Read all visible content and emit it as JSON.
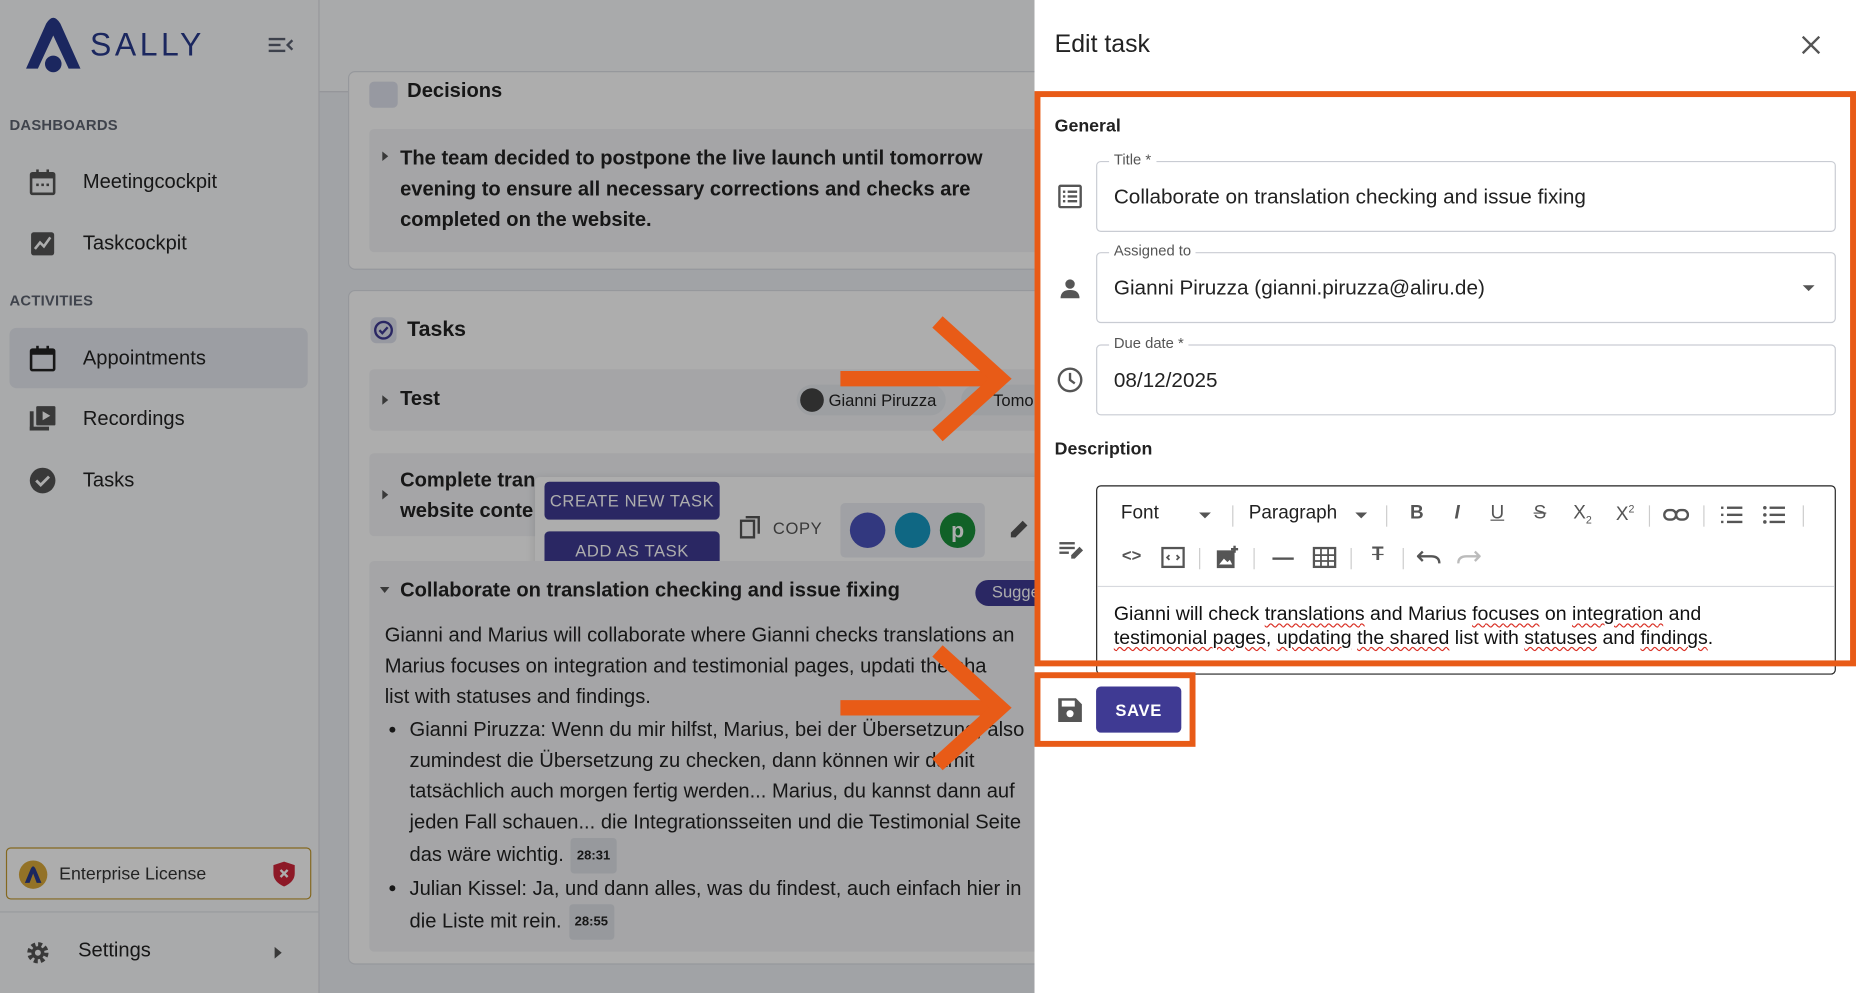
{
  "app": {
    "name": "SALLY"
  },
  "sidebar": {
    "section_dashboards": "DASHBOARDS",
    "section_activities": "ACTIVITIES",
    "items": [
      {
        "label": "Meetingcockpit",
        "icon": "calendar-icon"
      },
      {
        "label": "Taskcockpit",
        "icon": "chart-icon"
      },
      {
        "label": "Appointments",
        "icon": "calendar-icon",
        "active": true
      },
      {
        "label": "Recordings",
        "icon": "video-library-icon"
      },
      {
        "label": "Tasks",
        "icon": "check-circle-icon"
      }
    ],
    "license_label": "Enterprise License",
    "settings_label": "Settings"
  },
  "main": {
    "decisions_heading": "Decisions",
    "decision_text": "The team decided to postpone the live launch until tomorrow evening to ensure all necessary corrections and checks are completed on the website.",
    "tasks_heading": "Tasks",
    "task_test_title": "Test",
    "task_test_assignee": "Gianni Piruzza",
    "task_test_assignee2": "Tomo",
    "task2_title_line1": "Complete tran",
    "task2_title_line2": "website conte",
    "create_new_task": "CREATE NEW TASK",
    "add_as_task": "ADD AS TASK",
    "copy": "COPY",
    "task3_title": "Collaborate on translation checking and issue fixing",
    "task3_badge": "Sugge",
    "task3_desc_lines": [
      "Gianni and Marius will collaborate where Gianni checks translations an",
      "Marius focuses on integration and testimonial pages, updati  the sha",
      "list with statuses and findings."
    ],
    "bullet1_lines": [
      "Gianni Piruzza: Wenn du mir hilfst, Marius, bei der Übersetzung, also",
      "zumindest die Übersetzung zu checken, dann können wir damit",
      "tatsächlich auch morgen fertig werden... Marius, du kannst dann auf",
      "jeden Fall schauen... die Integrationsseiten und die Testimonial Seite",
      "das wäre wichtig."
    ],
    "bullet1_time": "28:31",
    "bullet2_lines": [
      "Julian Kissel: Ja, und dann alles, was du findest, auch einfach hier in",
      "die Liste mit rein."
    ],
    "bullet2_time": "28:55"
  },
  "drawer": {
    "title": "Edit task",
    "general_heading": "General",
    "title_label": "Title *",
    "title_value": "Collaborate on translation checking and issue fixing",
    "assigned_label": "Assigned to",
    "assigned_value": "Gianni Piruzza (gianni.piruzza@aliru.de)",
    "due_label": "Due date *",
    "due_value": "08/12/2025",
    "description_heading": "Description",
    "font_select": "Font",
    "paragraph_select": "Paragraph",
    "description_line1_parts": [
      "Gianni will check ",
      "translations",
      " and Marius ",
      "focuses",
      " on ",
      "integration",
      " and"
    ],
    "description_line2_parts": [
      "testimonial pages",
      ", ",
      "updating",
      " ",
      "the shared",
      " list with ",
      "statuses",
      " and ",
      "findings",
      "."
    ],
    "save_label": "SAVE"
  },
  "colors": {
    "accent": "#3f3a93",
    "highlight": "#e85b17",
    "logo": "#283a8c"
  }
}
